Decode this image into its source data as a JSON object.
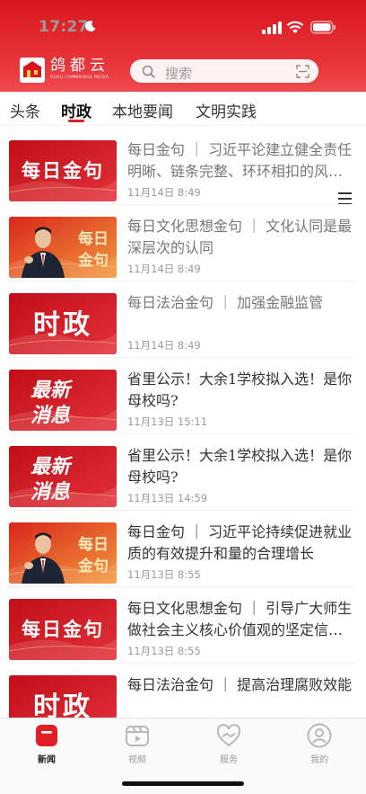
{
  "status": {
    "time": "17:27"
  },
  "brand": {
    "name": "鸽都云",
    "sub": "GEHU COMMRIDGE MEDIA"
  },
  "search": {
    "placeholder": "搜索"
  },
  "tabs": [
    {
      "label": "头条",
      "active": false
    },
    {
      "label": "时政",
      "active": true
    },
    {
      "label": "本地要闻",
      "active": false
    },
    {
      "label": "文明实践",
      "active": false
    }
  ],
  "news": [
    {
      "thumb": "每日金句",
      "thumb_type": "daily",
      "title": "每日金句 ｜ 习近平论建立健全责任明晰、链条完整、环环相扣的风险防控体系",
      "time": "11月14日 8:49",
      "read": true
    },
    {
      "thumb": "每日金句",
      "thumb_type": "portrait",
      "title": "每日文化思想金句 ｜ 文化认同是最深层次的认同",
      "time": "11月14日 8:49",
      "read": true
    },
    {
      "thumb": "时政",
      "thumb_type": "politics",
      "title": "每日法治金句 ｜ 加强金融监管",
      "time": "11月14日 8:49",
      "read": true
    },
    {
      "thumb": "最新消息",
      "thumb_type": "latest",
      "title": "省里公示！大余1学校拟入选！是你母校吗?",
      "time": "11月13日 15:11",
      "read": false
    },
    {
      "thumb": "最新消息",
      "thumb_type": "latest",
      "title": "省里公示！大余1学校拟入选！是你母校吗?",
      "time": "11月13日 14:59",
      "read": false
    },
    {
      "thumb": "每日金句",
      "thumb_type": "portrait",
      "title": "每日金句 ｜ 习近平论持续促进就业质的有效提升和量的合理增长",
      "time": "11月13日 8:55",
      "read": false
    },
    {
      "thumb": "每日金句",
      "thumb_type": "daily",
      "title": "每日文化思想金句 ｜ 引导广大师生做社会主义核心价值观的坚定信仰者",
      "time": "11月13日 8:55",
      "read": false
    },
    {
      "thumb": "时政",
      "thumb_type": "politics",
      "title": "每日法治金句 ｜ 提高治理腐败效能",
      "time": "",
      "read": false
    }
  ],
  "bottom_nav": [
    {
      "label": "新闻",
      "icon": "news-icon",
      "active": true
    },
    {
      "label": "视频",
      "icon": "video-icon",
      "active": false
    },
    {
      "label": "服务",
      "icon": "service-icon",
      "active": false
    },
    {
      "label": "我的",
      "icon": "profile-icon",
      "active": false
    }
  ],
  "colors": {
    "brand_red": "#e02025",
    "text": "#333333",
    "muted": "#9b9b9b"
  }
}
